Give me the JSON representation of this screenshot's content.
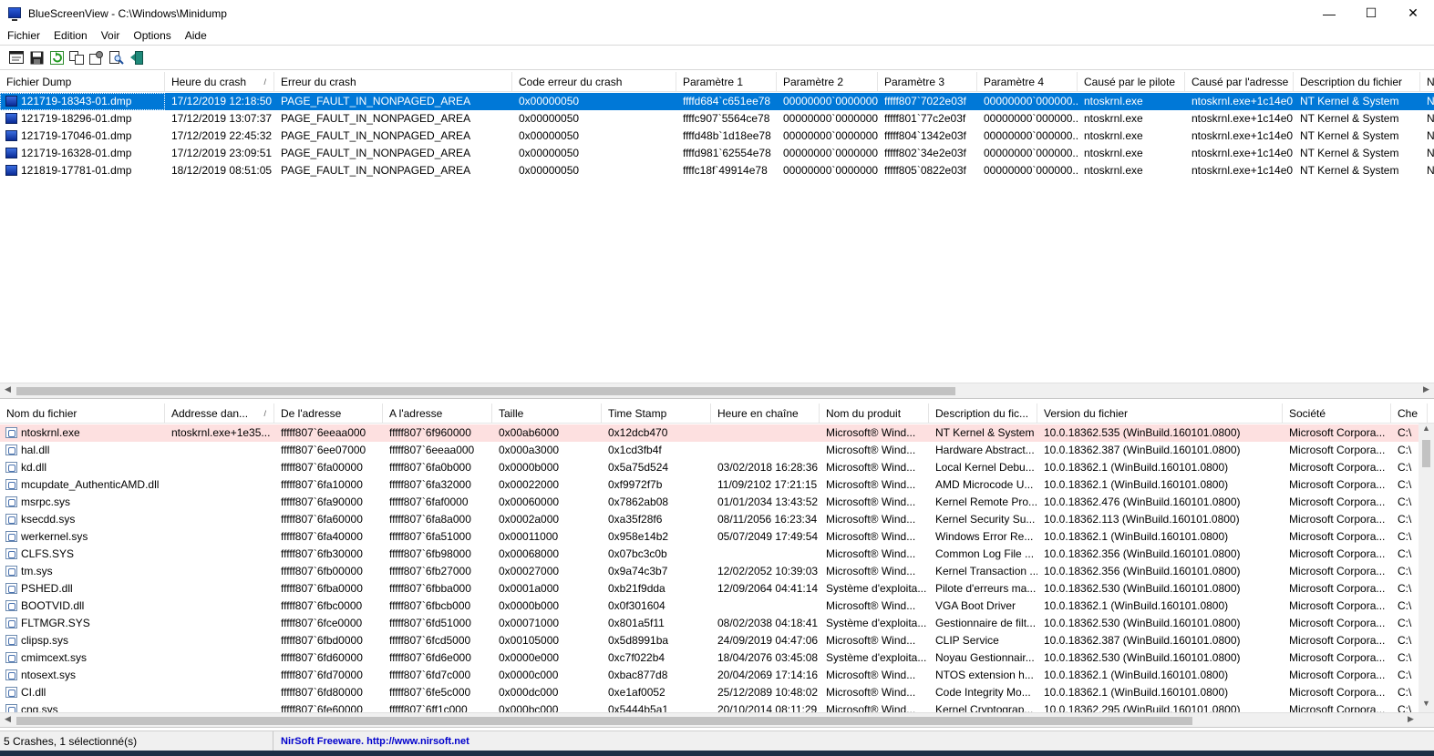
{
  "window": {
    "title": "BlueScreenView  -  C:\\Windows\\Minidump",
    "minimize": "—",
    "maximize": "☐",
    "close": "✕"
  },
  "menu": [
    "Fichier",
    "Edition",
    "Voir",
    "Options",
    "Aide"
  ],
  "toolbar": [
    "html-report-icon",
    "save-icon",
    "refresh-icon",
    "copy-icon",
    "properties-icon",
    "find-icon",
    "exit-icon"
  ],
  "crashes": {
    "columns": [
      "Fichier Dump",
      "Heure du crash",
      "Erreur du crash",
      "Code erreur du crash",
      "Paramètre 1",
      "Paramètre 2",
      "Paramètre 3",
      "Paramètre 4",
      "Causé par le pilote",
      "Causé par l'adresse",
      "Description du fichier",
      "N"
    ],
    "sort_indicator": "/",
    "rows": [
      [
        "121719-18343-01.dmp",
        "17/12/2019 12:18:50",
        "PAGE_FAULT_IN_NONPAGED_AREA",
        "0x00000050",
        "ffffd684`c651ee78",
        "00000000`00000000",
        "fffff807`7022e03f",
        "00000000`000000...",
        "ntoskrnl.exe",
        "ntoskrnl.exe+1c14e0",
        "NT Kernel & System",
        "N"
      ],
      [
        "121719-18296-01.dmp",
        "17/12/2019 13:07:37",
        "PAGE_FAULT_IN_NONPAGED_AREA",
        "0x00000050",
        "ffffc907`5564ce78",
        "00000000`00000000",
        "fffff801`77c2e03f",
        "00000000`000000...",
        "ntoskrnl.exe",
        "ntoskrnl.exe+1c14e0",
        "NT Kernel & System",
        "N"
      ],
      [
        "121719-17046-01.dmp",
        "17/12/2019 22:45:32",
        "PAGE_FAULT_IN_NONPAGED_AREA",
        "0x00000050",
        "ffffd48b`1d18ee78",
        "00000000`00000000",
        "fffff804`1342e03f",
        "00000000`000000...",
        "ntoskrnl.exe",
        "ntoskrnl.exe+1c14e0",
        "NT Kernel & System",
        "N"
      ],
      [
        "121719-16328-01.dmp",
        "17/12/2019 23:09:51",
        "PAGE_FAULT_IN_NONPAGED_AREA",
        "0x00000050",
        "ffffd981`62554e78",
        "00000000`00000000",
        "fffff802`34e2e03f",
        "00000000`000000...",
        "ntoskrnl.exe",
        "ntoskrnl.exe+1c14e0",
        "NT Kernel & System",
        "N"
      ],
      [
        "121819-17781-01.dmp",
        "18/12/2019 08:51:05",
        "PAGE_FAULT_IN_NONPAGED_AREA",
        "0x00000050",
        "ffffc18f`49914e78",
        "00000000`00000000",
        "fffff805`0822e03f",
        "00000000`000000...",
        "ntoskrnl.exe",
        "ntoskrnl.exe+1c14e0",
        "NT Kernel & System",
        "N"
      ]
    ]
  },
  "drivers": {
    "columns": [
      "Nom du fichier",
      "Addresse dan...",
      "De l'adresse",
      "A l'adresse",
      "Taille",
      "Time Stamp",
      "Heure en chaîne",
      "Nom du produit",
      "Description du fic...",
      "Version du fichier",
      "Société",
      "Che"
    ],
    "sort_indicator": "/",
    "rows": [
      [
        "ntoskrnl.exe",
        "ntoskrnl.exe+1e35...",
        "fffff807`6eeaa000",
        "fffff807`6f960000",
        "0x00ab6000",
        "0x12dcb470",
        "",
        "Microsoft® Wind...",
        "NT Kernel & System",
        "10.0.18362.535 (WinBuild.160101.0800)",
        "Microsoft Corpora...",
        "C:\\"
      ],
      [
        "hal.dll",
        "",
        "fffff807`6ee07000",
        "fffff807`6eeaa000",
        "0x000a3000",
        "0x1cd3fb4f",
        "",
        "Microsoft® Wind...",
        "Hardware Abstract...",
        "10.0.18362.387 (WinBuild.160101.0800)",
        "Microsoft Corpora...",
        "C:\\"
      ],
      [
        "kd.dll",
        "",
        "fffff807`6fa00000",
        "fffff807`6fa0b000",
        "0x0000b000",
        "0x5a75d524",
        "03/02/2018 16:28:36",
        "Microsoft® Wind...",
        "Local Kernel Debu...",
        "10.0.18362.1 (WinBuild.160101.0800)",
        "Microsoft Corpora...",
        "C:\\"
      ],
      [
        "mcupdate_AuthenticAMD.dll",
        "",
        "fffff807`6fa10000",
        "fffff807`6fa32000",
        "0x00022000",
        "0xf9972f7b",
        "11/09/2102 17:21:15",
        "Microsoft® Wind...",
        "AMD Microcode U...",
        "10.0.18362.1 (WinBuild.160101.0800)",
        "Microsoft Corpora...",
        "C:\\"
      ],
      [
        "msrpc.sys",
        "",
        "fffff807`6fa90000",
        "fffff807`6faf0000",
        "0x00060000",
        "0x7862ab08",
        "01/01/2034 13:43:52",
        "Microsoft® Wind...",
        "Kernel Remote Pro...",
        "10.0.18362.476 (WinBuild.160101.0800)",
        "Microsoft Corpora...",
        "C:\\"
      ],
      [
        "ksecdd.sys",
        "",
        "fffff807`6fa60000",
        "fffff807`6fa8a000",
        "0x0002a000",
        "0xa35f28f6",
        "08/11/2056 16:23:34",
        "Microsoft® Wind...",
        "Kernel Security Su...",
        "10.0.18362.113 (WinBuild.160101.0800)",
        "Microsoft Corpora...",
        "C:\\"
      ],
      [
        "werkernel.sys",
        "",
        "fffff807`6fa40000",
        "fffff807`6fa51000",
        "0x00011000",
        "0x958e14b2",
        "05/07/2049 17:49:54",
        "Microsoft® Wind...",
        "Windows Error Re...",
        "10.0.18362.1 (WinBuild.160101.0800)",
        "Microsoft Corpora...",
        "C:\\"
      ],
      [
        "CLFS.SYS",
        "",
        "fffff807`6fb30000",
        "fffff807`6fb98000",
        "0x00068000",
        "0x07bc3c0b",
        "",
        "Microsoft® Wind...",
        "Common Log File ...",
        "10.0.18362.356 (WinBuild.160101.0800)",
        "Microsoft Corpora...",
        "C:\\"
      ],
      [
        "tm.sys",
        "",
        "fffff807`6fb00000",
        "fffff807`6fb27000",
        "0x00027000",
        "0x9a74c3b7",
        "12/02/2052 10:39:03",
        "Microsoft® Wind...",
        "Kernel Transaction ...",
        "10.0.18362.356 (WinBuild.160101.0800)",
        "Microsoft Corpora...",
        "C:\\"
      ],
      [
        "PSHED.dll",
        "",
        "fffff807`6fba0000",
        "fffff807`6fbba000",
        "0x0001a000",
        "0xb21f9dda",
        "12/09/2064 04:41:14",
        "Système d'exploita...",
        "Pilote d'erreurs ma...",
        "10.0.18362.530 (WinBuild.160101.0800)",
        "Microsoft Corpora...",
        "C:\\"
      ],
      [
        "BOOTVID.dll",
        "",
        "fffff807`6fbc0000",
        "fffff807`6fbcb000",
        "0x0000b000",
        "0x0f301604",
        "",
        "Microsoft® Wind...",
        "VGA Boot Driver",
        "10.0.18362.1 (WinBuild.160101.0800)",
        "Microsoft Corpora...",
        "C:\\"
      ],
      [
        "FLTMGR.SYS",
        "",
        "fffff807`6fce0000",
        "fffff807`6fd51000",
        "0x00071000",
        "0x801a5f11",
        "08/02/2038 04:18:41",
        "Système d'exploita...",
        "Gestionnaire de filt...",
        "10.0.18362.530 (WinBuild.160101.0800)",
        "Microsoft Corpora...",
        "C:\\"
      ],
      [
        "clipsp.sys",
        "",
        "fffff807`6fbd0000",
        "fffff807`6fcd5000",
        "0x00105000",
        "0x5d8991ba",
        "24/09/2019 04:47:06",
        "Microsoft® Wind...",
        "CLIP Service",
        "10.0.18362.387 (WinBuild.160101.0800)",
        "Microsoft Corpora...",
        "C:\\"
      ],
      [
        "cmimcext.sys",
        "",
        "fffff807`6fd60000",
        "fffff807`6fd6e000",
        "0x0000e000",
        "0xc7f022b4",
        "18/04/2076 03:45:08",
        "Système d'exploita...",
        "Noyau Gestionnair...",
        "10.0.18362.530 (WinBuild.160101.0800)",
        "Microsoft Corpora...",
        "C:\\"
      ],
      [
        "ntosext.sys",
        "",
        "fffff807`6fd70000",
        "fffff807`6fd7c000",
        "0x0000c000",
        "0xbac877d8",
        "20/04/2069 17:14:16",
        "Microsoft® Wind...",
        "NTOS extension h...",
        "10.0.18362.1 (WinBuild.160101.0800)",
        "Microsoft Corpora...",
        "C:\\"
      ],
      [
        "CI.dll",
        "",
        "fffff807`6fd80000",
        "fffff807`6fe5c000",
        "0x000dc000",
        "0xe1af0052",
        "25/12/2089 10:48:02",
        "Microsoft® Wind...",
        "Code Integrity Mo...",
        "10.0.18362.1 (WinBuild.160101.0800)",
        "Microsoft Corpora...",
        "C:\\"
      ],
      [
        "cng.sys",
        "",
        "fffff807`6fe60000",
        "fffff807`6ff1c000",
        "0x000bc000",
        "0x5444b5a1",
        "20/10/2014 08:11:29",
        "Microsoft® Wind...",
        "Kernel Cryptograp...",
        "10.0.18362.295 (WinBuild.160101.0800)",
        "Microsoft Corpora...",
        "C:\\"
      ]
    ]
  },
  "status": {
    "left": "5 Crashes, 1 sélectionné(s)",
    "right": "NirSoft Freeware.  http://www.nirsoft.net"
  },
  "colors": {
    "selection": "#0078d7",
    "highlight_row": "#fde0e0",
    "link": "#0000cc"
  }
}
